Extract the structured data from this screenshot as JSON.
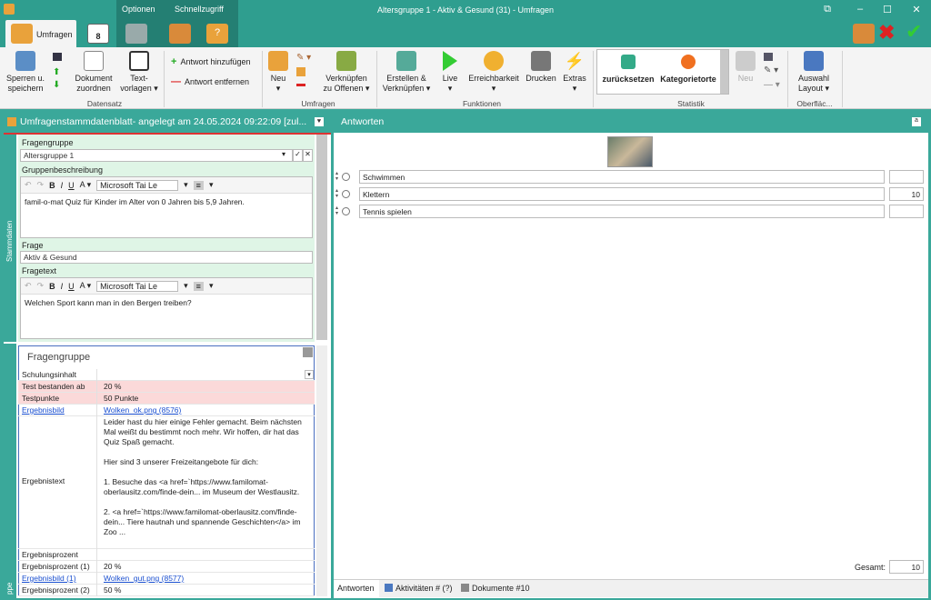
{
  "window": {
    "title": "Altersgruppe 1 - Aktiv & Gesund (31) - Umfragen",
    "context_tabs": [
      "Optionen",
      "Schnellzugriff"
    ]
  },
  "tabs": {
    "active": "Umfragen"
  },
  "ribbon": {
    "datensatz": {
      "group_label": "Datensatz",
      "sperren": "Sperren u.",
      "sperren2": "speichern",
      "dokument": "Dokument",
      "dokument2": "zuordnen",
      "textvorlagen": "Text-",
      "textvorlagen2": "vorlagen ▾"
    },
    "umfragen": {
      "group_label": "Umfragen",
      "antwort_add": "Antwort hinzufügen",
      "antwort_remove": "Antwort entfernen",
      "neu": "Neu",
      "verknuepfen": "Verknüpfen",
      "verknuepfen2": "zu Offenen ▾"
    },
    "funktionen": {
      "group_label": "Funktionen",
      "erstellen": "Erstellen &",
      "erstellen2": "Verknüpfen ▾",
      "live": "Live",
      "erreichbarkeit": "Erreichbarkeit",
      "drucken": "Drucken",
      "extras": "Extras"
    },
    "statistik": {
      "group_label": "Statistik",
      "zurueck": "zurücksetzen",
      "kategorie": "Kategorietorte",
      "neu": "Neu"
    },
    "oberflaeche": {
      "group_label": "Oberfläc...",
      "auswahl": "Auswahl",
      "layout": "Layout ▾"
    }
  },
  "left": {
    "header": "Umfragenstammdatenblatt- angelegt am 24.05.2024 09:22:09 [zul...",
    "vtab_top": "Stammdaten",
    "vtab_bottom": "ppe",
    "fragengruppe_label": "Fragengruppe",
    "fragengruppe_value": "Altersgruppe 1",
    "gruppenbeschreibung_label": "Gruppenbeschreibung",
    "font_name": "Microsoft Tai Le",
    "gruppenbeschreibung_text": "famil-o-mat Quiz für Kinder im Alter von 0 Jahren bis 5,9 Jahren.",
    "frage_label": "Frage",
    "frage_value": "Aktiv & Gesund",
    "fragetext_label": "Fragetext",
    "fragetext_text": "Welchen Sport kann man in den Bergen treiben?",
    "section_title": "Fragengruppe",
    "props": {
      "schulungsinhalt": "Schulungsinhalt",
      "test_bestanden": "Test bestanden ab",
      "test_bestanden_v": "20 %",
      "testpunkte": "Testpunkte",
      "testpunkte_v": "50 Punkte",
      "ergebnisbild": "Ergebnisbild",
      "ergebnisbild_v": "Wolken_ok.png (8576)",
      "ergebnistext": "Ergebnistext",
      "ergebnistext_v": "Leider hast du hier einige Fehler gemacht. Beim nächsten Mal weißt du bestimmt noch mehr. Wir hoffen, dir hat das Quiz Spaß gemacht.\n\nHier sind 3 unserer Freizeitangebote für dich:\n\n1. Besuche das <a href=`https://www.familomat-oberlausitz.com/finde-dein... im Museum der Westlausitz.\n\n2. <a href=`https://www.familomat-oberlausitz.com/finde-dein... Tiere hautnah und spannende Geschichten</a> im Zoo ...",
      "ergebnisprozent": "Ergebnisprozent",
      "ergebnisprozent1": "Ergebnisprozent (1)",
      "ergebnisprozent1_v": "20 %",
      "ergebnisbild1": "Ergebnisbild (1)",
      "ergebnisbild1_v": "Wolken_gut.png (8577)",
      "ergebnisprozent2": "Ergebnisprozent (2)",
      "ergebnisprozent2_v": "50 %"
    }
  },
  "right": {
    "header": "Antworten",
    "answers": [
      {
        "text": "Schwimmen",
        "value": ""
      },
      {
        "text": "Klettern",
        "value": "10"
      },
      {
        "text": "Tennis spielen",
        "value": ""
      }
    ],
    "gesamt_label": "Gesamt:",
    "gesamt_value": "10",
    "bottom_tabs": [
      "Antworten",
      "Aktivitäten # (?)",
      "Dokumente #10"
    ]
  },
  "colors": {
    "accent": "#3aa89a",
    "context": "#247f73",
    "pink": "#fbd9d9",
    "green": "#dff5e6"
  }
}
